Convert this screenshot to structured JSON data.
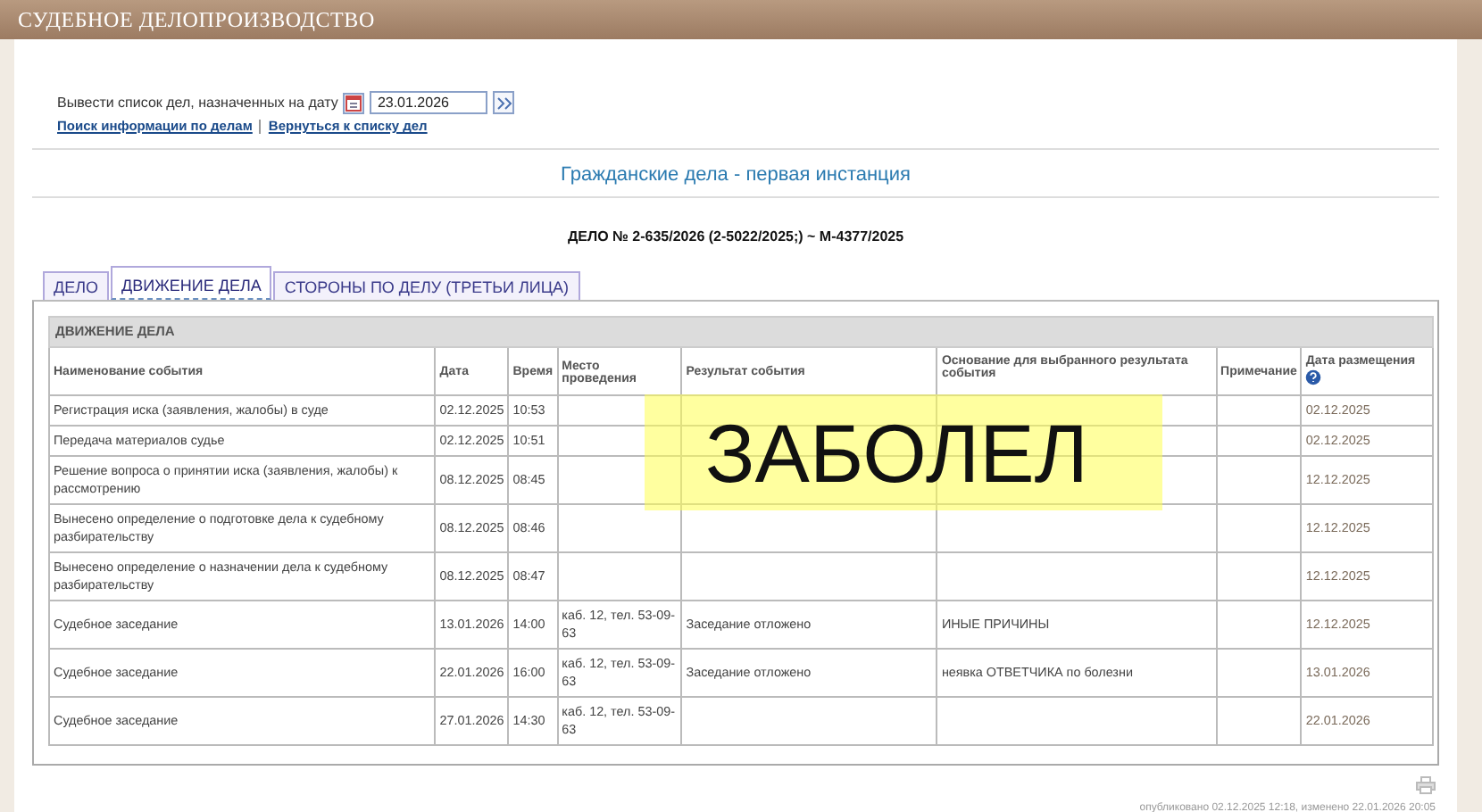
{
  "window": {
    "title": "СУДЕБНОЕ ДЕЛОПРОИЗВОДСТВО"
  },
  "date_filter": {
    "label": "Вывести список дел, назначенных на дату",
    "value": "23.01.2026"
  },
  "links": [
    "Поиск информации по делам",
    "Вернуться к списку дел"
  ],
  "section_title": "Гражданские дела - первая инстанция",
  "case_title": "ДЕЛО № 2-635/2026 (2-5022/2025;) ~ М-4377/2025",
  "tabs": [
    {
      "label": "ДЕЛО",
      "selected": false
    },
    {
      "label": "ДВИЖЕНИЕ ДЕЛА",
      "selected": true
    },
    {
      "label": "СТОРОНЫ ПО ДЕЛУ (ТРЕТЬИ ЛИЦА)",
      "selected": false
    }
  ],
  "table": {
    "caption": "ДВИЖЕНИЕ ДЕЛА",
    "columns": [
      "Наименование события",
      "Дата",
      "Время",
      "Место проведения",
      "Результат события",
      "Основание для выбранного результата события",
      "Примечание",
      "Дата размещения"
    ],
    "rows": [
      {
        "event": "Регистрация иска (заявления, жалобы) в суде",
        "date": "02.12.2025",
        "time": "10:53",
        "posted": "02.12.2025"
      },
      {
        "event": "Передача материалов судье",
        "date": "02.12.2025",
        "time": "10:51",
        "posted": "02.12.2025"
      },
      {
        "event": "Решение вопроса о принятии иска (заявления, жалобы) к рассмотрению",
        "date": "08.12.2025",
        "time": "08:45",
        "posted": "12.12.2025"
      },
      {
        "event": "Вынесено определение о подготовке дела к судебному разбирательству",
        "date": "08.12.2025",
        "time": "08:46",
        "posted": "12.12.2025"
      },
      {
        "event": "Вынесено определение о назначении дела к судебному разбирательству",
        "date": "08.12.2025",
        "time": "08:47",
        "posted": "12.12.2025"
      },
      {
        "event": "Судебное заседание",
        "date": "13.01.2026",
        "time": "14:00",
        "place": "каб. 12, тел. 53-09-63",
        "result": "Заседание отложено",
        "basis": "ИНЫЕ ПРИЧИНЫ",
        "posted": "12.12.2025"
      },
      {
        "event": "Судебное заседание",
        "date": "22.01.2026",
        "time": "16:00",
        "place": "каб. 12, тел. 53-09-63",
        "result": "Заседание отложено",
        "basis": "неявка ОТВЕТЧИКА по болезни",
        "posted": "13.01.2026"
      },
      {
        "event": "Судебное заседание",
        "date": "27.01.2026",
        "time": "14:30",
        "place": "каб. 12, тел. 53-09-63",
        "posted": "22.01.2026"
      }
    ]
  },
  "overlay_note": "ЗАБОЛЕЛ",
  "footer": "опубликовано 02.12.2025 12:18, изменено 22.01.2026 20:05"
}
